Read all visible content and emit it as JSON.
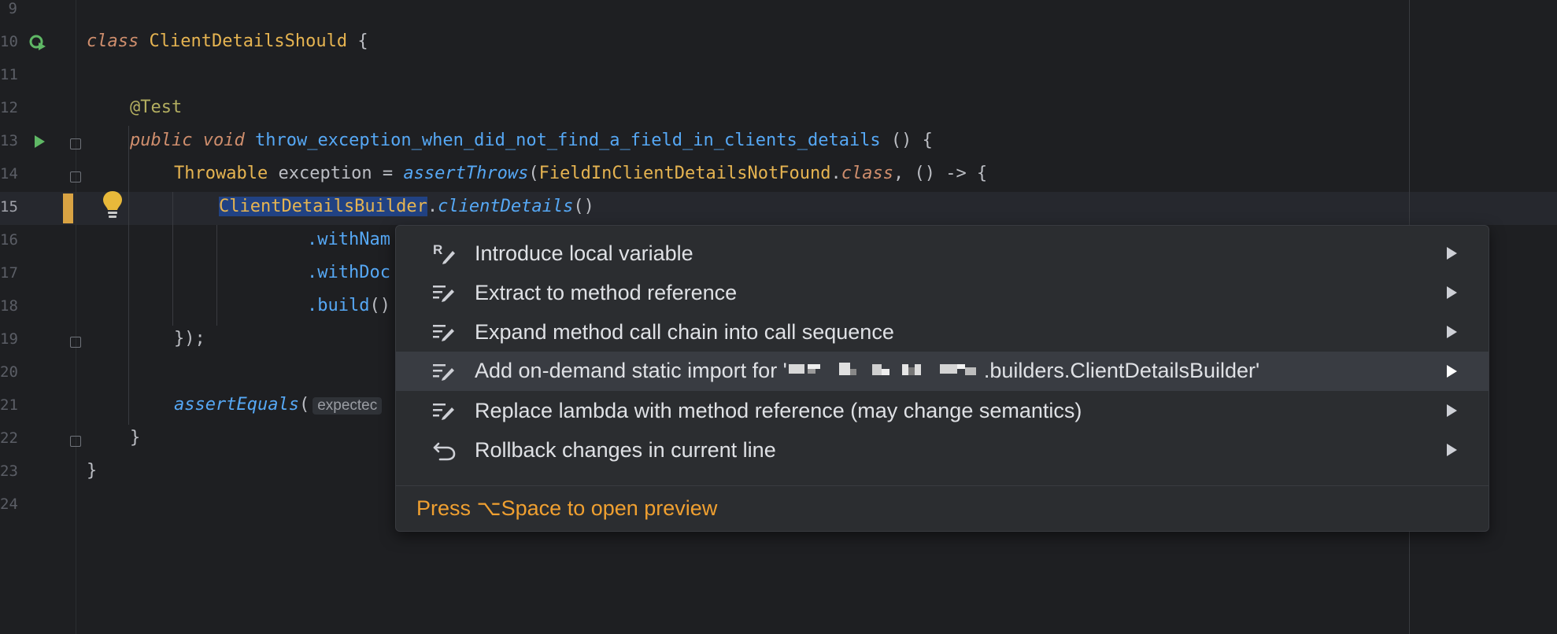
{
  "editor": {
    "line_numbers": [
      "9",
      "10",
      "11",
      "12",
      "13",
      "14",
      "15",
      "16",
      "17",
      "18",
      "19",
      "20",
      "21",
      "22",
      "23",
      "24"
    ],
    "code": {
      "line10": {
        "kw": "class",
        "name": "ClientDetailsShould",
        "brace": "{"
      },
      "line12": {
        "annotation": "@Test"
      },
      "line13": {
        "kw1": "public",
        "kw2": "void",
        "method": "throw_exception_when_did_not_find_a_field_in_clients_details",
        "rest": " () {"
      },
      "line14": {
        "type": "Throwable",
        "var": " exception = ",
        "call": "assertThrows",
        "open": "(",
        "cls": "FieldInClientDetailsNotFound",
        "dot": ".",
        "kwclass": "class",
        "rest": ", () -> {"
      },
      "line15": {
        "cls": "ClientDetailsBuilder",
        "dot": ".",
        "method": "clientDetails",
        "rest": "()"
      },
      "line16": {
        "method": ".withNam"
      },
      "line17": {
        "method": ".withDoc"
      },
      "line18": {
        "method": ".build",
        "rest": "()"
      },
      "line19": {
        "text": "});"
      },
      "line21": {
        "call": "assertEquals",
        "open": "(",
        "hint": "expectec"
      },
      "line22": {
        "text": "}"
      },
      "line23": {
        "text": "}"
      }
    }
  },
  "intention_popup": {
    "items": [
      {
        "label": "Introduce local variable",
        "icon": "refactor-icon"
      },
      {
        "label": "Extract to method reference",
        "icon": "edit-lines-icon"
      },
      {
        "label": "Expand method call chain into call sequence",
        "icon": "edit-lines-icon"
      },
      {
        "label_prefix": "Add on-demand static import for '",
        "label_suffix": ".builders.ClientDetailsBuilder'",
        "icon": "edit-lines-icon",
        "selected": true
      },
      {
        "label": "Replace lambda with method reference (may change semantics)",
        "icon": "edit-lines-icon"
      },
      {
        "label": "Rollback changes in current line",
        "icon": "undo-icon"
      }
    ],
    "footer": "Press ⌥Space to open preview"
  },
  "colors": {
    "accent": "#f0a030",
    "change_marker": "#d9a343",
    "selection": "#393c42"
  }
}
